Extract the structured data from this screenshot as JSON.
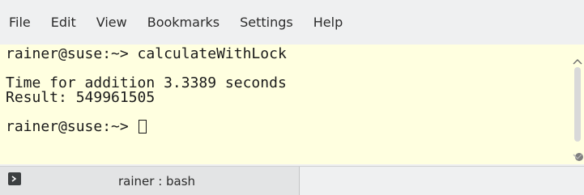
{
  "menubar": {
    "items": [
      "File",
      "Edit",
      "View",
      "Bookmarks",
      "Settings",
      "Help"
    ]
  },
  "terminal": {
    "lines": [
      "rainer@suse:~> calculateWithLock",
      "",
      "Time for addition 3.3389 seconds",
      "Result: 549961505",
      "",
      "rainer@suse:~> "
    ],
    "background": "#ffffe0"
  },
  "tabs": [
    {
      "label": "rainer : bash",
      "icon": "terminal-icon"
    }
  ]
}
